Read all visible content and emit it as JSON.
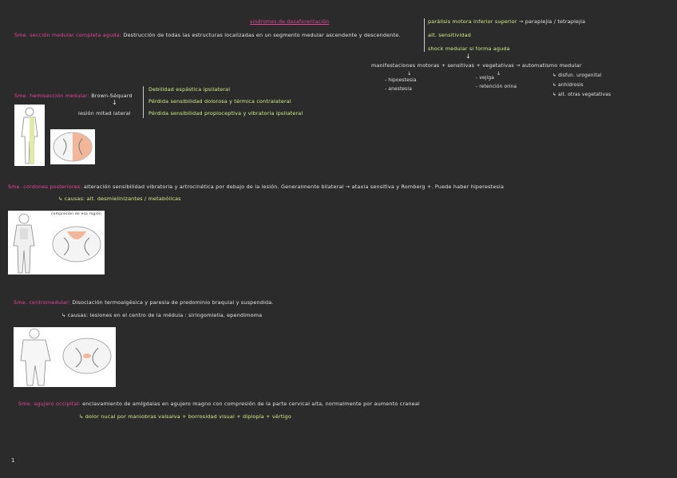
{
  "title": "sindromes de desaferentación",
  "s1": {
    "label": "Sme. sección medular completa aguda:",
    "text": "Destrucción de todas las estructuras localizadas en un segmento medular ascendente y descendente."
  },
  "topright": {
    "l1a": "parálisis motora inferior superior",
    "l1b": "→ paraplejia / tetraplejia",
    "l2": "alt. sensitividad",
    "l3": "shock medular si forma aguda",
    "arrow": "↓",
    "manif": "manifestaciones motoras + sensitivas + vegetativas → automatismo medular",
    "down1": "↓",
    "down2": "↓",
    "col1": [
      "- hipoestesia",
      "- anestesia"
    ],
    "col2": [
      "- vejiga",
      "- retención orina"
    ],
    "col3": [
      "↳ disfun. urogenital",
      "↳ anhidrosis",
      "↳ alt. otras vegetativas"
    ]
  },
  "s2": {
    "label": "Sme. hemisección medular:",
    "tag": "Brown-Séquard",
    "arrow": "↓",
    "sub": "lesión mitad lateral",
    "items": [
      "Debilidad espástica ipsilateral",
      "Pérdida sensibilidad dolorosa y térmica contralateral",
      "Pérdida sensibilidad propioceptiva y vibratoria ipsilateral"
    ]
  },
  "s3": {
    "label": "Sme. cordones posteriores:",
    "text": "alteración sensibilidad vibratoria y artrocinética por debajo de la lesión. Generalmente bilateral → ataxia sensitiva y Romberg +. Puede haber hiperestesia",
    "cause": "↳ causas: alt. desmielinizantes / metabólicas",
    "caption": "compresión de esa región"
  },
  "s4": {
    "label": "Sme. centromedular:",
    "text": "Disociación termoalgésica y paresia de predominio braquial y suspendida.",
    "cause": "↳ causas: lesiones en el centro de la médula : siringomielia, ependimoma"
  },
  "s5": {
    "label": "Sme. agujero occipital:",
    "text": "enclavamiento de amígdalas en agujero magno con compresión de la parte cervical alta, normalmente por aumento craneal",
    "cause": "↳ dolor nucal por maniobras valsalva + borrosidad visual + diplopía + vértigo"
  },
  "page_number": "1"
}
